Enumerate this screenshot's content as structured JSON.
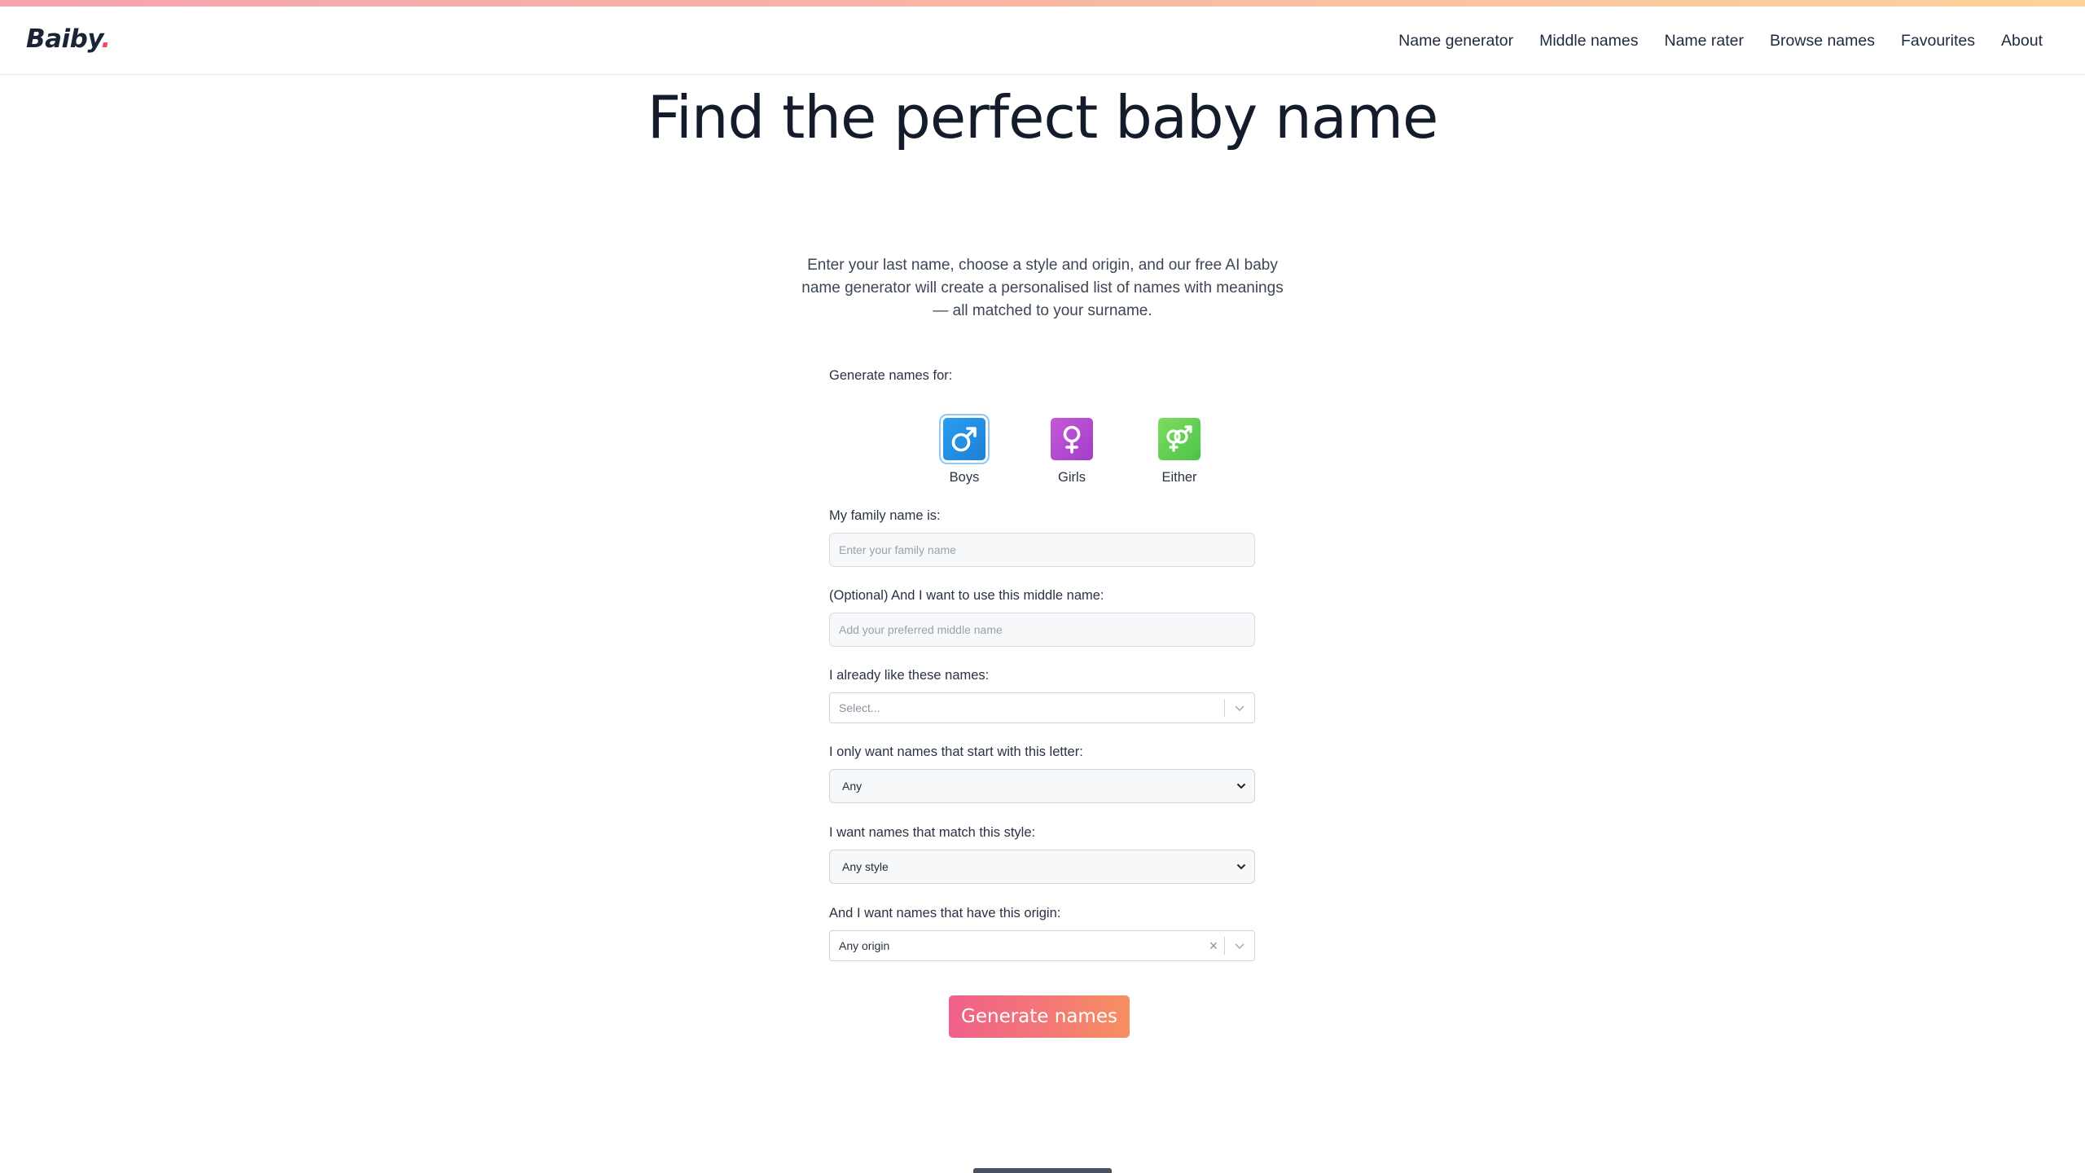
{
  "brand": {
    "logo_text": "Baiby",
    "logo_dot": "."
  },
  "nav": {
    "items": [
      {
        "label": "Name generator"
      },
      {
        "label": "Middle names"
      },
      {
        "label": "Name rater"
      },
      {
        "label": "Browse names"
      },
      {
        "label": "Favourites"
      },
      {
        "label": "About"
      }
    ]
  },
  "hero": {
    "title": "Find the perfect baby name",
    "subtitle": "Enter your last name, choose a style and origin, and our free AI baby name generator will create a personalised list of names with meanings — all matched to your surname."
  },
  "form": {
    "generate_for_label": "Generate names for:",
    "genders": [
      {
        "label": "Boys",
        "icon": "male-symbol-icon",
        "selected": true
      },
      {
        "label": "Girls",
        "icon": "female-symbol-icon",
        "selected": false
      },
      {
        "label": "Either",
        "icon": "male-female-symbol-icon",
        "selected": false
      }
    ],
    "family_name": {
      "label": "My family name is:",
      "placeholder": "Enter your family name",
      "value": ""
    },
    "middle_name": {
      "label": "(Optional) And I want to use this middle name:",
      "placeholder": "Add your preferred middle name",
      "value": ""
    },
    "liked_names": {
      "label": "I already like these names:",
      "placeholder": "Select..."
    },
    "start_letter": {
      "label": "I only want names that start with this letter:",
      "value": "Any"
    },
    "style": {
      "label": "I want names that match this style:",
      "value": "Any style"
    },
    "origin": {
      "label": "And I want names that have this origin:",
      "value": "Any origin"
    },
    "submit_label": "Generate names"
  },
  "colors": {
    "boys": "#2a9ef0",
    "girls": "#b84bd0",
    "either": "#5ccc50",
    "accent_start": "#f0608a",
    "accent_end": "#f79060"
  }
}
